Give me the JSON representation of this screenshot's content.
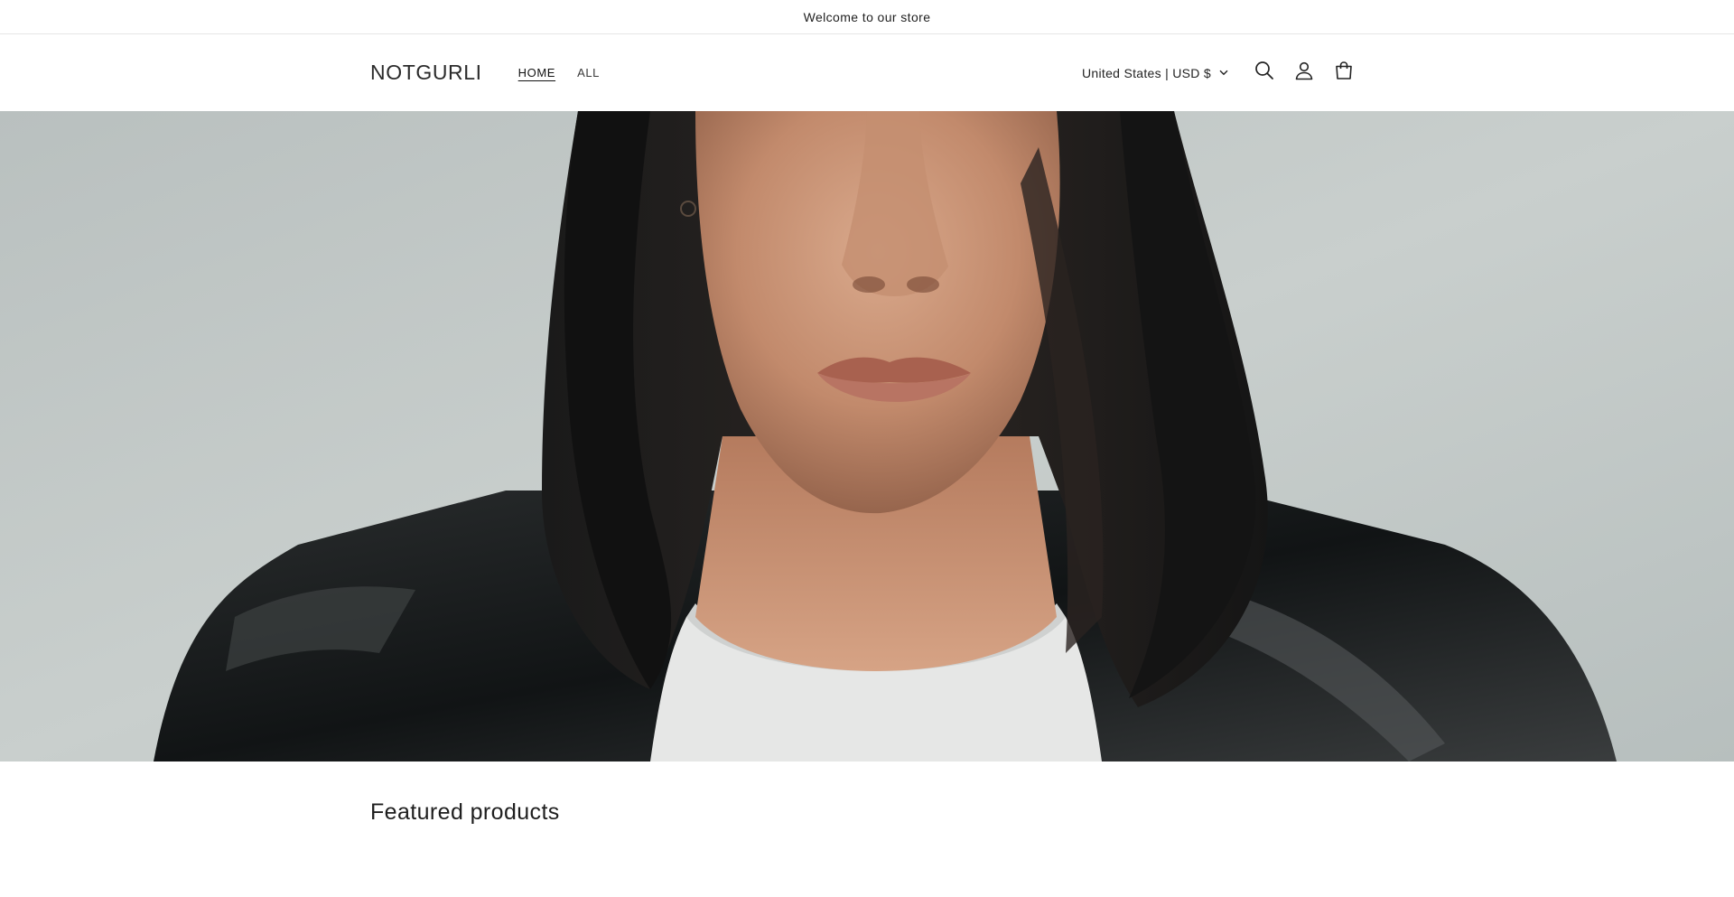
{
  "announcement": {
    "text": "Welcome to our store"
  },
  "header": {
    "logo": "NOTGURLI",
    "nav": [
      {
        "label": "HOME",
        "active": true
      },
      {
        "label": "ALL",
        "active": false
      }
    ],
    "country_selector": "United States | USD $",
    "icons": [
      "search-icon",
      "account-icon",
      "cart-icon"
    ]
  },
  "hero": {
    "image": "portrait-woman-bob-haircut-leather-jacket"
  },
  "featured": {
    "title": "Featured products"
  },
  "colors": {
    "text": "#121212",
    "border": "#e6e6e6",
    "hero_bg": "#c2c8c7"
  }
}
